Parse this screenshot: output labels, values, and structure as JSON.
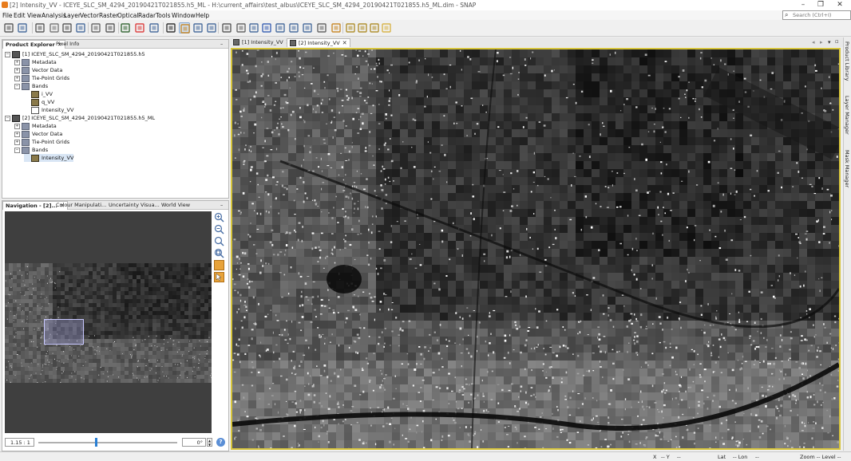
{
  "window": {
    "title": "[2] Intensity_VV - ICEYE_SLC_SM_4294_20190421T021855.h5_ML - H:\\current_affairs\\test_albus\\ICEYE_SLC_SM_4294_20190421T021855.h5_ML.dim - SNAP",
    "minimize": "–",
    "maximize": "❐",
    "close": "✕"
  },
  "menubar": {
    "items": [
      "File",
      "Edit",
      "View",
      "Analysis",
      "Layer",
      "Vector",
      "Raster",
      "Optical",
      "Radar",
      "Tools",
      "Window",
      "Help"
    ],
    "search_placeholder": "Search (Ctrl+I)"
  },
  "toolbar": {
    "icons": [
      "open-product-icon",
      "save-product-icon",
      "session-icon",
      "gcp-tool-icon",
      "pin-tool-icon",
      "graph-builder-icon",
      "gcp-icon",
      "ellipse-icon",
      "vector-icon",
      "rgb-icon",
      "mask-icon",
      "select-tool-icon",
      "pan-tool-icon",
      "zoom-tool-icon",
      "zoom-region-icon",
      "gcp-placement-icon",
      "line-tool-icon",
      "polyline-tool-icon",
      "rectangle-tool-icon",
      "polygon-tool-icon",
      "ellipse-tool-icon",
      "range-finder-icon",
      "tile-icon",
      "measure-icon",
      "tile-horizontal-icon",
      "tile-vertical-icon",
      "tile-evenly-icon",
      "folder-icon"
    ]
  },
  "product_explorer": {
    "tabs": [
      "Product Explorer",
      "Pixel Info"
    ],
    "tree": [
      {
        "label": "[1] ICEYE_SLC_SM_4294_20190421T021855.h5",
        "kind": "product",
        "level": 0,
        "exp": "−"
      },
      {
        "label": "Metadata",
        "kind": "folder",
        "level": 1,
        "exp": "+"
      },
      {
        "label": "Vector Data",
        "kind": "folder",
        "level": 1,
        "exp": "+"
      },
      {
        "label": "Tie-Point Grids",
        "kind": "folder",
        "level": 1,
        "exp": "+"
      },
      {
        "label": "Bands",
        "kind": "folder",
        "level": 1,
        "exp": "−"
      },
      {
        "label": "i_VV",
        "kind": "band",
        "level": 2,
        "exp": ""
      },
      {
        "label": "q_VV",
        "kind": "band",
        "level": 2,
        "exp": ""
      },
      {
        "label": "Intensity_VV",
        "kind": "vband",
        "level": 2,
        "exp": ""
      },
      {
        "label": "[2] ICEYE_SLC_SM_4294_20190421T021855.h5_ML",
        "kind": "product",
        "level": 0,
        "exp": "−"
      },
      {
        "label": "Metadata",
        "kind": "folder",
        "level": 1,
        "exp": "+"
      },
      {
        "label": "Vector Data",
        "kind": "folder",
        "level": 1,
        "exp": "+"
      },
      {
        "label": "Tie-Point Grids",
        "kind": "folder",
        "level": 1,
        "exp": "+"
      },
      {
        "label": "Bands",
        "kind": "folder",
        "level": 1,
        "exp": "−"
      },
      {
        "label": "Intensity_VV",
        "kind": "band",
        "level": 2,
        "exp": "",
        "selected": true
      }
    ]
  },
  "navigation": {
    "tabs": [
      "Navigation - [2]...",
      "Colour Manipulati...",
      "Uncertainty Visua...",
      "World View"
    ],
    "scale": "1.15 : 1",
    "angle": "0°",
    "zoom_slider_fraction": 0.41,
    "help": "?"
  },
  "editor": {
    "tabs": [
      "[1] Intensity_VV",
      "[2] Intensity_VV"
    ],
    "active_tab": 1
  },
  "right_rail": {
    "items": [
      "Product Library",
      "Layer Manager",
      "Mask Manager"
    ]
  },
  "statusbar": {
    "x": "X",
    "x_val": "-- Y",
    "y_val": "--",
    "lat": "Lat",
    "lat_val": "-- Lon",
    "lon_val": "--",
    "zoom": "Zoom -- Level --"
  },
  "colors": {
    "view_border": "#d7c53c",
    "slider_thumb": "#2a7fd4",
    "accent": "#e87d1e"
  }
}
